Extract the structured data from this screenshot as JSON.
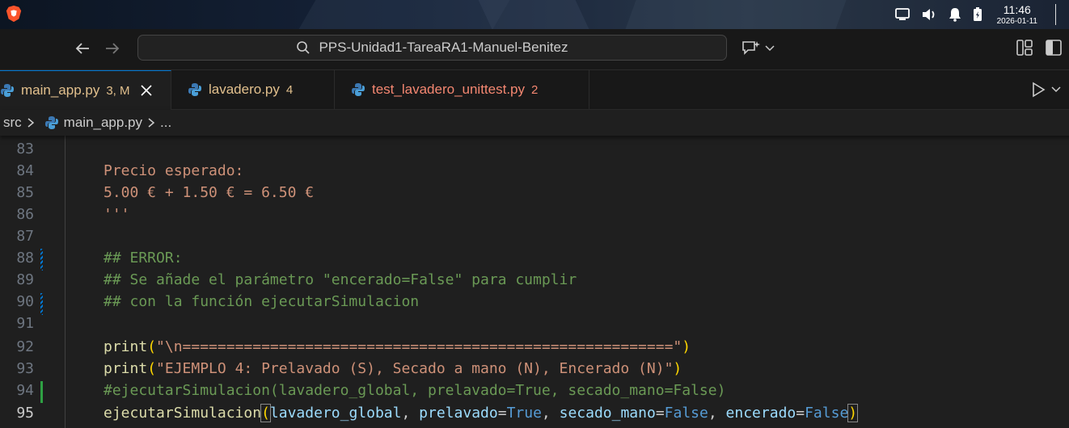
{
  "taskbar": {
    "time": "11:46",
    "date": "2026-01-11"
  },
  "titlebar": {
    "search_text": "PPS-Unidad1-TareaRA1-Manuel-Benitez"
  },
  "tabs": [
    {
      "filename": "main_app.py",
      "badge": "3, M",
      "color": "#e2c08d"
    },
    {
      "filename": "lavadero.py",
      "badge": "4",
      "color": "#e2c08d"
    },
    {
      "filename": "test_lavadero_unittest.py",
      "badge": "2",
      "color": "#f48771"
    }
  ],
  "breadcrumb": {
    "folder": "src",
    "file": "main_app.py",
    "more": "..."
  },
  "editor": {
    "lines": [
      {
        "num": "83",
        "text": ""
      },
      {
        "num": "84",
        "text": "Precio esperado:"
      },
      {
        "num": "85",
        "text": "5.00 € + 1.50 € = 6.50 €"
      },
      {
        "num": "86",
        "text": "'''"
      },
      {
        "num": "87",
        "text": ""
      },
      {
        "num": "88",
        "text": "## ERROR:"
      },
      {
        "num": "89",
        "text": "## Se añade el parámetro \"encerado=False\" para cumplir"
      },
      {
        "num": "90",
        "text": "## con la función ejecutarSimulacion"
      },
      {
        "num": "91",
        "text": ""
      },
      {
        "num": "92",
        "print": "print",
        "open": "(",
        "str": "\"\\n========================================================\"",
        "close": ")"
      },
      {
        "num": "93",
        "print": "print",
        "open": "(",
        "str": "\"EJEMPLO 4: Prelavado (S), Secado a mano (N), Encerado (N)\"",
        "close": ")"
      },
      {
        "num": "94",
        "text": "#ejecutarSimulacion(lavadero_global, prelavado=True, secado_mano=False)"
      },
      {
        "num": "95",
        "fn": "ejecutarSimulacion",
        "open": "(",
        "arg0": "lavadero_global",
        "comma": ", ",
        "k1": "prelavado",
        "v1": "True",
        "k2": "secado_mano",
        "v2": "False",
        "k3": "encerado",
        "v3": "False",
        "eq": "=",
        "close": ")"
      }
    ]
  },
  "colors": {
    "accent": "#0078d4",
    "string": "#ce9178",
    "comment": "#6a9955",
    "function": "#dcdcaa",
    "keyword": "#569cd6"
  }
}
